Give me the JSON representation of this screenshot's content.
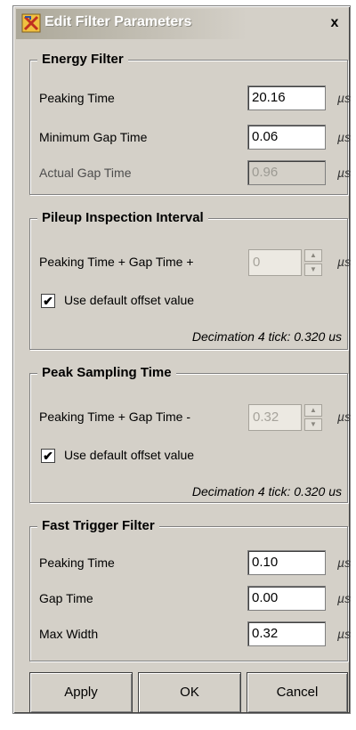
{
  "window": {
    "title": "Edit Filter Parameters",
    "close_label": "x",
    "icon": "filter-tool-icon"
  },
  "energy_filter": {
    "legend": "Energy Filter",
    "peaking_time": {
      "label": "Peaking Time",
      "value": "20.16",
      "unit": "µs"
    },
    "minimum_gap_time": {
      "label": "Minimum Gap Time",
      "value": "0.06",
      "unit": "µs"
    },
    "actual_gap_time": {
      "label": "Actual Gap Time",
      "value": "0.96",
      "unit": "µs"
    }
  },
  "pileup_inspection": {
    "legend": "Pileup Inspection Interval",
    "row_label": "Peaking Time + Gap Time +",
    "value": "0",
    "unit": "µs",
    "checkbox_label": "Use default offset value",
    "checked": true,
    "note": "Decimation 4 tick: 0.320 us"
  },
  "peak_sampling": {
    "legend": "Peak Sampling Time",
    "row_label": "Peaking Time + Gap Time -",
    "value": "0.32",
    "unit": "µs",
    "checkbox_label": "Use default offset value",
    "checked": true,
    "note": "Decimation 4 tick: 0.320 us"
  },
  "fast_trigger": {
    "legend": "Fast Trigger Filter",
    "peaking_time": {
      "label": "Peaking Time",
      "value": "0.10",
      "unit": "µs"
    },
    "gap_time": {
      "label": "Gap Time",
      "value": "0.00",
      "unit": "µs"
    },
    "max_width": {
      "label": "Max Width",
      "value": "0.32",
      "unit": "µs"
    }
  },
  "buttons": {
    "apply": "Apply",
    "ok": "OK",
    "cancel": "Cancel"
  },
  "checkmark": "✔",
  "spin_up": "▲",
  "spin_down": "▼"
}
